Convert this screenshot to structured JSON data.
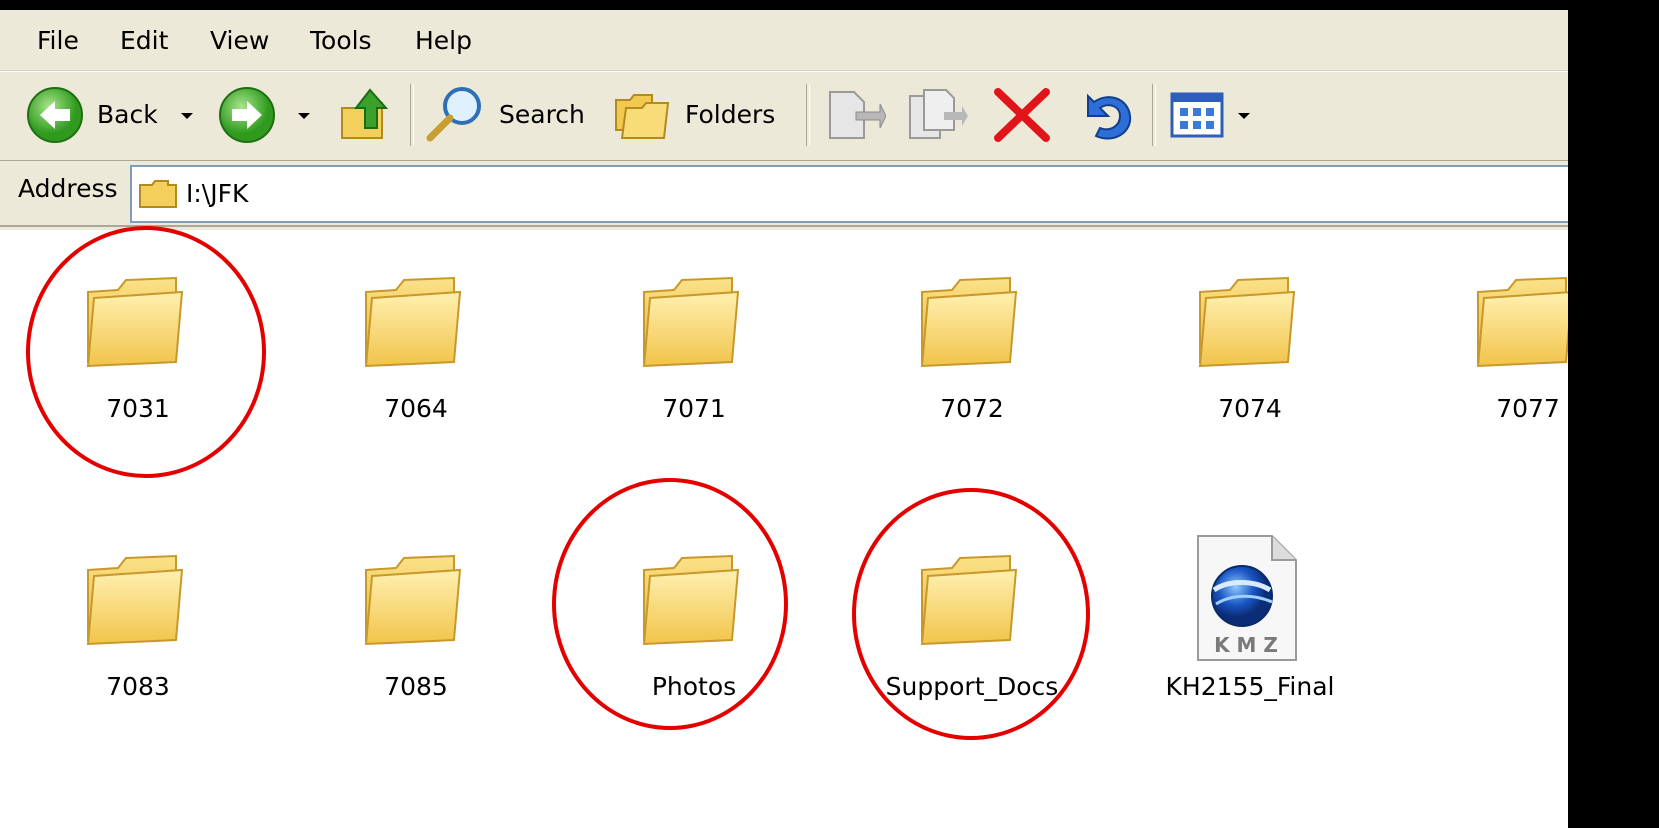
{
  "menu": {
    "items": [
      {
        "label": "File"
      },
      {
        "label": "Edit"
      },
      {
        "label": "View"
      },
      {
        "label": "Tools"
      },
      {
        "label": "Help"
      }
    ]
  },
  "toolbar": {
    "back_label": "Back",
    "search_label": "Search",
    "folders_label": "Folders",
    "icons": {
      "back": "back-arrow-icon",
      "forward": "forward-arrow-icon",
      "up": "up-folder-icon",
      "search": "magnifier-icon",
      "folders": "folders-icon",
      "move": "move-to-icon",
      "copy": "copy-to-icon",
      "delete": "delete-x-icon",
      "undo": "undo-icon",
      "views": "views-icon"
    }
  },
  "address": {
    "label": "Address",
    "value": "I:\\JFK"
  },
  "files": [
    {
      "name": "7031",
      "type": "folder",
      "circled": true
    },
    {
      "name": "7064",
      "type": "folder",
      "circled": false
    },
    {
      "name": "7071",
      "type": "folder",
      "circled": false
    },
    {
      "name": "7072",
      "type": "folder",
      "circled": false
    },
    {
      "name": "7074",
      "type": "folder",
      "circled": false
    },
    {
      "name": "7077",
      "type": "folder",
      "circled": false
    },
    {
      "name": "7083",
      "type": "folder",
      "circled": false
    },
    {
      "name": "7085",
      "type": "folder",
      "circled": false
    },
    {
      "name": "Photos",
      "type": "folder",
      "circled": true
    },
    {
      "name": "Support_Docs",
      "type": "folder",
      "circled": true
    },
    {
      "name": "KH2155_Final",
      "type": "kmz",
      "icon_text": "K M Z",
      "circled": false
    }
  ],
  "colors": {
    "highlight_circle": "#e50000",
    "chrome": "#ece9d8",
    "folder_fill": "#f6d86e"
  }
}
